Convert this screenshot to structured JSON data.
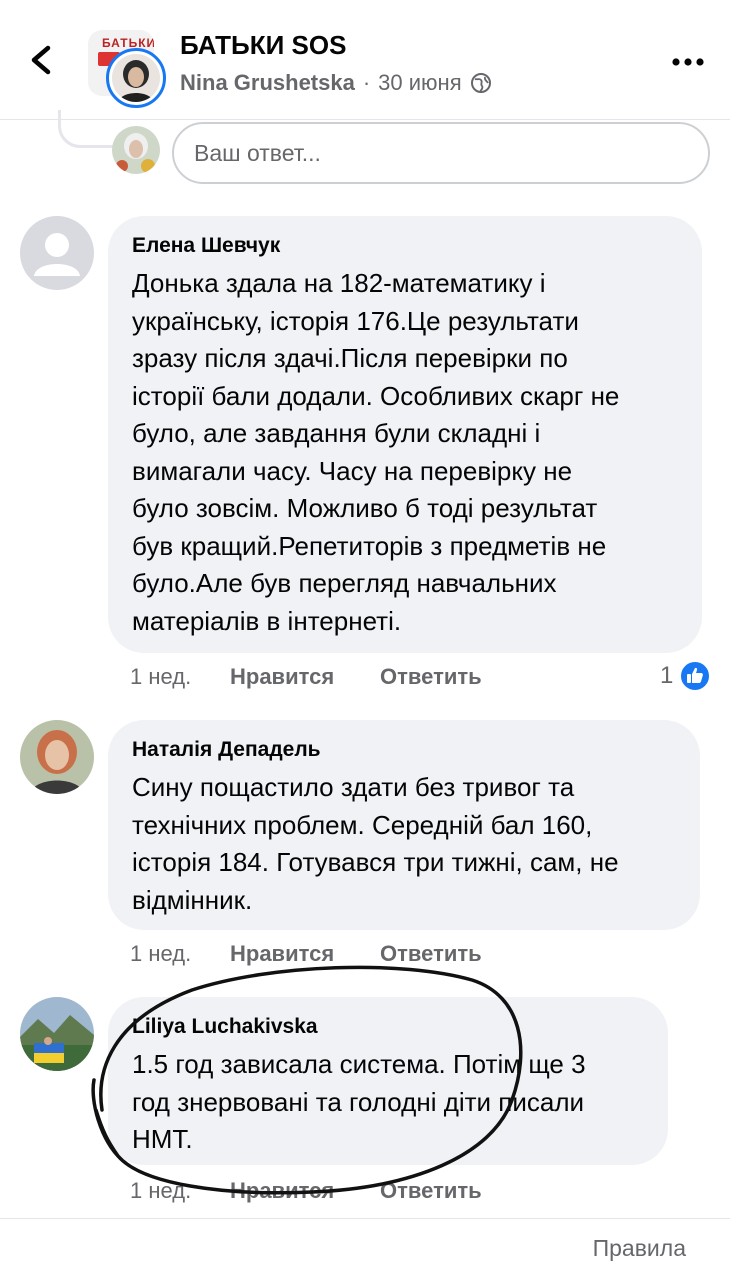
{
  "header": {
    "group_name": "БАТЬКИ SOS",
    "group_banner_text": "БАТЬКИ",
    "author": "Nina Grushetska",
    "separator": "·",
    "date": "30 июня",
    "privacy_icon": "globe-icon",
    "back_icon": "chevron-left-icon",
    "more_icon": "more-dots-icon"
  },
  "reply_box": {
    "placeholder": "Ваш ответ..."
  },
  "comments": [
    {
      "author": "Елена Шевчук",
      "avatar": "default-avatar",
      "text": "Донька здала на 182-математику і\nукраїнську, історія 176.Це результати\nзразу після здачі.Після перевірки по\nісторії бали додали. Особливих скарг не\nбуло, але завдання були складні і\nвимагали часу. Часу на перевірку не\nбуло зовсім. Можливо б тоді результат\nбув кращий.Репетиторів з предметів не\nбуло.Але був перегляд навчальних\nматеріалів в інтернеті.",
      "time": "1 нед.",
      "like_label": "Нравится",
      "reply_label": "Ответить",
      "reactions": "1"
    },
    {
      "author": "Наталія Депадель",
      "avatar": "user-photo",
      "text": "Сину пощастило здати без тривог та\nтехнічних проблем. Середній бал 160,\nісторія 184. Готувався три тижні, сам, не\nвідмінник.",
      "time": "1 нед.",
      "like_label": "Нравится",
      "reply_label": "Ответить"
    },
    {
      "author": "Liliya Luchakivska",
      "avatar": "user-photo",
      "text": "1.5 год зависала система. Потім ще 3\nгод знервовані та голодні діти писали\nНМТ.",
      "time": "1 нед.",
      "like_label": "Нравится",
      "reply_label": "Ответить"
    }
  ],
  "footer": {
    "rules_label": "Правила"
  },
  "colors": {
    "bubble": "#f0f2f5",
    "muted": "#65676b",
    "accent": "#1877f2",
    "annotation": "#111111"
  }
}
